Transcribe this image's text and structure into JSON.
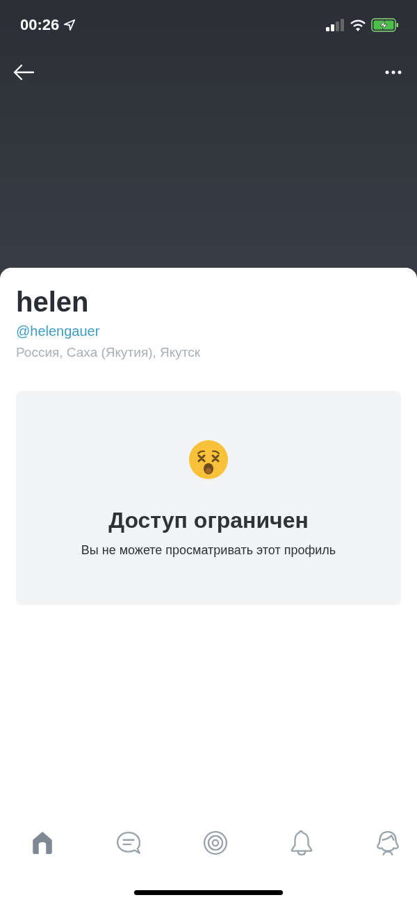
{
  "status_bar": {
    "time": "00:26"
  },
  "profile": {
    "name": "helen",
    "handle": "@helengauer",
    "location": "Россия, Саха (Якутия), Якутск"
  },
  "notice": {
    "title": "Доступ ограничен",
    "message": "Вы не можете просматривать этот профиль"
  },
  "tab_bar": [
    {
      "kind": "home",
      "selected": true
    },
    {
      "kind": "messages",
      "selected": false
    },
    {
      "kind": "target",
      "selected": false
    },
    {
      "kind": "notifications",
      "selected": false
    },
    {
      "kind": "profile",
      "selected": false
    }
  ]
}
